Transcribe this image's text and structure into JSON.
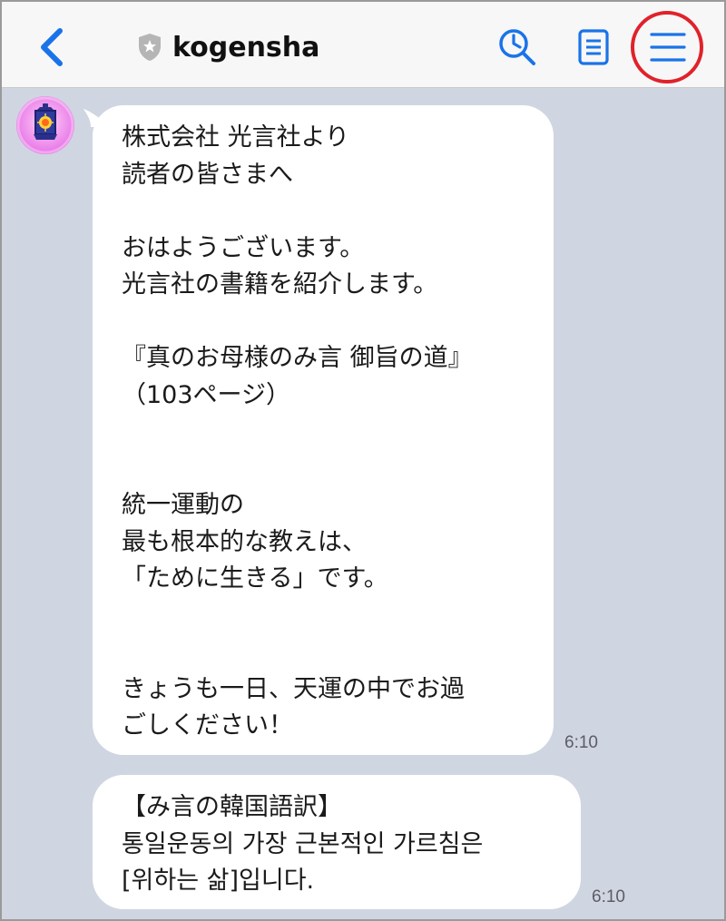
{
  "header": {
    "title": "kogensha",
    "icons": {
      "back": "chevron-left-icon",
      "verified": "shield-star-icon",
      "search": "search-clock-icon",
      "notes": "notes-icon",
      "menu": "hamburger-menu-icon"
    }
  },
  "colors": {
    "accent": "#1a73e8",
    "chat_background": "#cfd6e1",
    "header_background": "#f7f7f7",
    "highlight_circle": "#e0222a"
  },
  "messages": [
    {
      "text": "株式会社 光言社より\n読者の皆さまへ\n\nおはようございます。\n光言社の書籍を紹介します。\n\n『真のお母様のみ言 御旨の道』\n（103ページ）\n\n\n統一運動の\n最も根本的な教えは、\n「ために生きる」です。\n\n\nきょうも一日、天運の中でお過\nごしください！",
      "time": "6:10"
    },
    {
      "text": "【み言の韓国語訳】\n통일운동의 가장 근본적인 가르침은\n[위하는 삶]입니다.",
      "time": "6:10"
    }
  ]
}
